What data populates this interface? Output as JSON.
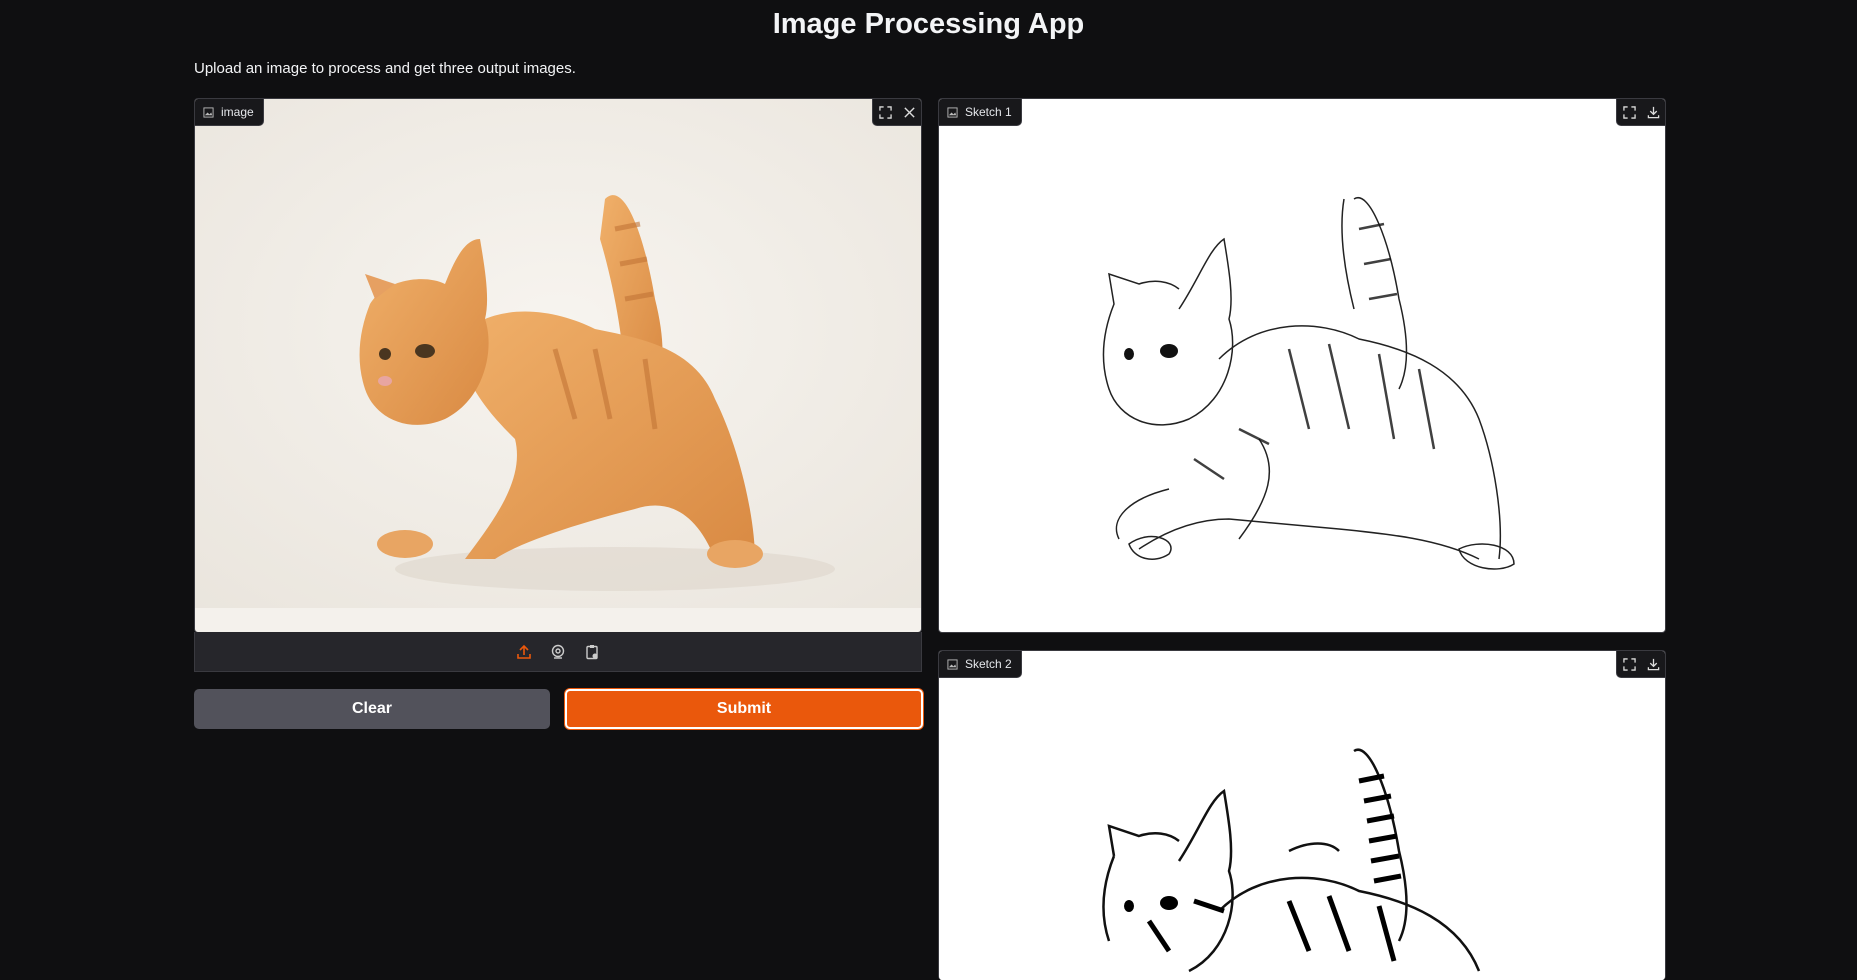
{
  "app": {
    "title": "Image Processing App",
    "description": "Upload an image to process and get three output images."
  },
  "input": {
    "label": "image",
    "label_icon": "image-icon",
    "header_icons": [
      "fullscreen-icon",
      "close-icon"
    ],
    "toolbar_icons": [
      "upload-icon",
      "webcam-icon",
      "clipboard-icon"
    ]
  },
  "outputs": [
    {
      "label": "Sketch 1",
      "label_icon": "image-icon",
      "header_icons": [
        "fullscreen-icon",
        "download-icon"
      ]
    },
    {
      "label": "Sketch 2",
      "label_icon": "image-icon",
      "header_icons": [
        "fullscreen-icon",
        "download-icon"
      ]
    }
  ],
  "buttons": {
    "clear_label": "Clear",
    "submit_label": "Submit"
  },
  "colors": {
    "background": "#0f0f11",
    "accent": "#ea580c",
    "secondary_button": "#52525b",
    "cat_orange": "#e39a55"
  }
}
